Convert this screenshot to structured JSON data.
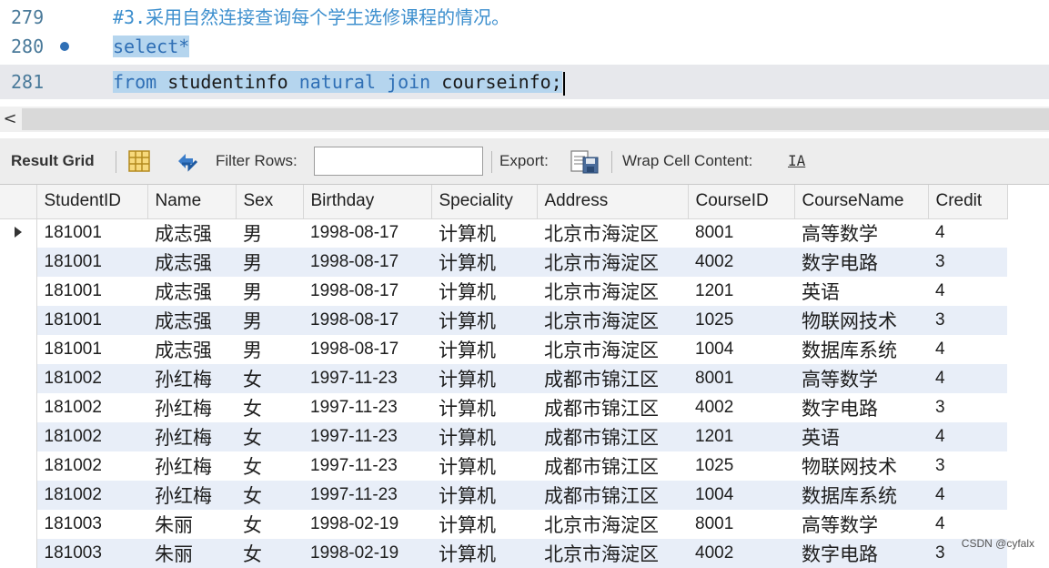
{
  "editor": {
    "lines": [
      {
        "number": "279",
        "comment": "#3.采用自然连接查询每个学生选修课程的情况。"
      },
      {
        "number": "280",
        "keyword": "select*"
      },
      {
        "number": "281",
        "kw_from": "from",
        "t1": " studentinfo ",
        "kw_natural": "natural",
        "sp1": " ",
        "kw_join": "join",
        "t2": " courseinfo;"
      }
    ]
  },
  "scrollbar": {
    "left_arrow": "<"
  },
  "toolbar": {
    "result_grid": "Result Grid",
    "filter_rows": "Filter Rows:",
    "filter_value": "",
    "export": "Export:",
    "wrap_cell": "Wrap Cell Content:",
    "wrap_icon_text": "IA"
  },
  "grid": {
    "columns": [
      "StudentID",
      "Name",
      "Sex",
      "Birthday",
      "Speciality",
      "Address",
      "CourseID",
      "CourseName",
      "Credit"
    ],
    "rows": [
      [
        "181001",
        "成志强",
        "男",
        "1998-08-17",
        "计算机",
        "北京市海淀区",
        "8001",
        "高等数学",
        "4"
      ],
      [
        "181001",
        "成志强",
        "男",
        "1998-08-17",
        "计算机",
        "北京市海淀区",
        "4002",
        "数字电路",
        "3"
      ],
      [
        "181001",
        "成志强",
        "男",
        "1998-08-17",
        "计算机",
        "北京市海淀区",
        "1201",
        "英语",
        "4"
      ],
      [
        "181001",
        "成志强",
        "男",
        "1998-08-17",
        "计算机",
        "北京市海淀区",
        "1025",
        "物联网技术",
        "3"
      ],
      [
        "181001",
        "成志强",
        "男",
        "1998-08-17",
        "计算机",
        "北京市海淀区",
        "1004",
        "数据库系统",
        "4"
      ],
      [
        "181002",
        "孙红梅",
        "女",
        "1997-11-23",
        "计算机",
        "成都市锦江区",
        "8001",
        "高等数学",
        "4"
      ],
      [
        "181002",
        "孙红梅",
        "女",
        "1997-11-23",
        "计算机",
        "成都市锦江区",
        "4002",
        "数字电路",
        "3"
      ],
      [
        "181002",
        "孙红梅",
        "女",
        "1997-11-23",
        "计算机",
        "成都市锦江区",
        "1201",
        "英语",
        "4"
      ],
      [
        "181002",
        "孙红梅",
        "女",
        "1997-11-23",
        "计算机",
        "成都市锦江区",
        "1025",
        "物联网技术",
        "3"
      ],
      [
        "181002",
        "孙红梅",
        "女",
        "1997-11-23",
        "计算机",
        "成都市锦江区",
        "1004",
        "数据库系统",
        "4"
      ],
      [
        "181003",
        "朱丽",
        "女",
        "1998-02-19",
        "计算机",
        "北京市海淀区",
        "8001",
        "高等数学",
        "4"
      ],
      [
        "181003",
        "朱丽",
        "女",
        "1998-02-19",
        "计算机",
        "北京市海淀区",
        "4002",
        "数字电路",
        "3"
      ]
    ]
  },
  "watermark": "CSDN @cyfalx",
  "colors": {
    "keyword": "#2f6fb5",
    "comment": "#3d8fce",
    "selection": "#b5d5ee",
    "row_alt": "#e8eef8"
  }
}
